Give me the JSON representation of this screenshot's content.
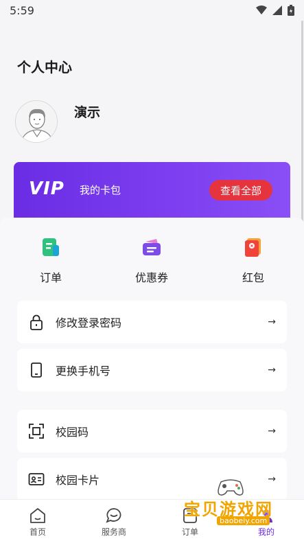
{
  "status_bar": {
    "time": "5:59"
  },
  "header": {
    "title": "个人中心"
  },
  "user": {
    "name": "演示"
  },
  "vip_card": {
    "logo": "VIP",
    "label": "我的卡包",
    "button": "查看全部",
    "accent": "#6b2de3",
    "button_color": "#e6343e"
  },
  "shortcuts": [
    {
      "label": "订单",
      "icon": "order-icon"
    },
    {
      "label": "优惠券",
      "icon": "coupon-icon"
    },
    {
      "label": "红包",
      "icon": "red-packet-icon"
    }
  ],
  "menu": [
    {
      "label": "修改登录密码",
      "icon": "lock-icon",
      "arrow": "→"
    },
    {
      "label": "更换手机号",
      "icon": "phone-icon",
      "arrow": "→"
    },
    {
      "label": "校园码",
      "icon": "scan-icon",
      "arrow": "→"
    },
    {
      "label": "校园卡片",
      "icon": "id-card-icon",
      "arrow": "→"
    }
  ],
  "tabs": [
    {
      "label": "首页",
      "icon": "home-icon"
    },
    {
      "label": "服务商",
      "icon": "chat-icon"
    },
    {
      "label": "订单",
      "icon": "order-tab-icon"
    },
    {
      "label": "我的",
      "icon": "profile-icon",
      "active": true
    }
  ],
  "watermark": {
    "text": "宝贝游戏网",
    "url": "baobeiy.com"
  }
}
